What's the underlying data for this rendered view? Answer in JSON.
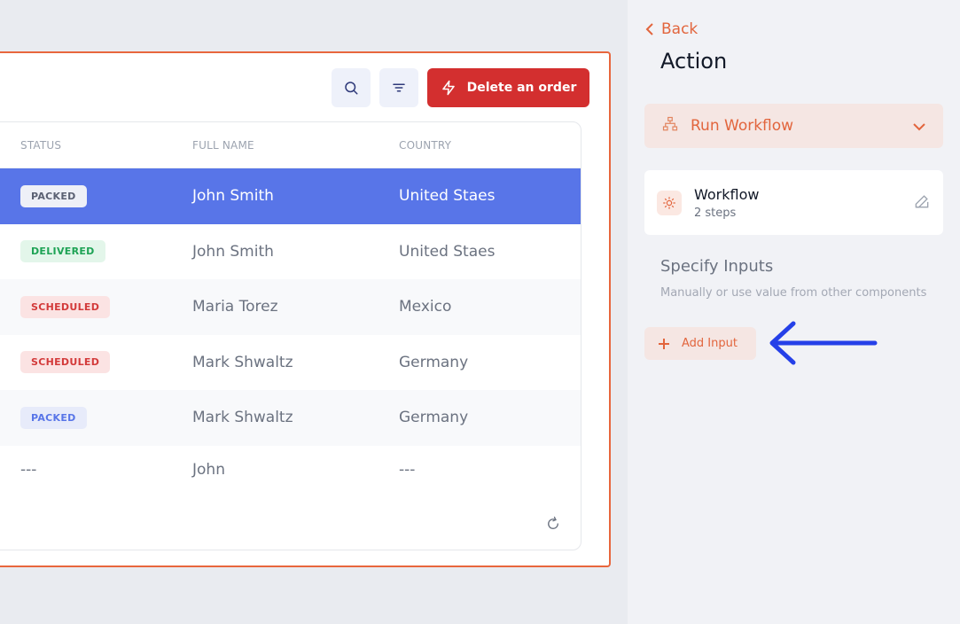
{
  "toolbar": {
    "search_icon": "search-icon",
    "filter_icon": "filter-icon",
    "danger_button_label": "Delete an order",
    "danger_button_icon": "lightning-icon"
  },
  "table": {
    "columns": [
      "STATUS",
      "FULL NAME",
      "COUNTRY"
    ],
    "rows": [
      {
        "status": "PACKED",
        "name": "John Smith",
        "country": "United Staes",
        "selected": true
      },
      {
        "status": "DELIVERED",
        "name": "John Smith",
        "country": "United Staes"
      },
      {
        "status": "SCHEDULED",
        "name": "Maria Torez",
        "country": "Mexico"
      },
      {
        "status": "SCHEDULED",
        "name": "Mark Shwaltz",
        "country": "Germany"
      },
      {
        "status": "PACKED",
        "name": "Mark Shwaltz",
        "country": "Germany"
      },
      {
        "status": "---",
        "name": "John",
        "country": "---"
      }
    ],
    "refresh_icon": "refresh-icon"
  },
  "panel": {
    "back_label": "Back",
    "title": "Action",
    "workflow_select_label": "Run Workflow",
    "workflow_card": {
      "name": "Workflow",
      "steps": "2 steps"
    },
    "inputs_title": "Specify Inputs",
    "inputs_subtitle": "Manually or use value from other components",
    "add_input_label": "Add Input"
  },
  "colors": {
    "accent": "#e2653d",
    "selected_row": "#5875e8",
    "danger": "#d32f2f",
    "annotation_arrow": "#2540e8"
  }
}
